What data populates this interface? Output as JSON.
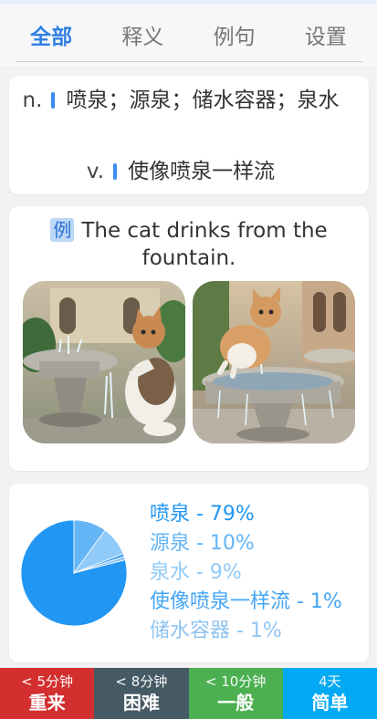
{
  "tabs": [
    {
      "label": "全部",
      "active": true
    },
    {
      "label": "释义",
      "active": false
    },
    {
      "label": "例句",
      "active": false
    },
    {
      "label": "设置",
      "active": false
    }
  ],
  "definitions": [
    {
      "pos": "n.",
      "text": "喷泉；源泉；储水容器；泉水"
    },
    {
      "pos": "v.",
      "text": "使像喷泉一样流"
    }
  ],
  "example": {
    "badge": "例",
    "sentence": "The cat drinks from the fountain.",
    "images": [
      {
        "icon": "cat-fountain-photo-1"
      },
      {
        "icon": "cat-fountain-photo-2"
      }
    ]
  },
  "stats": {
    "items": [
      {
        "label": "喷泉 - 79%",
        "percent": 79,
        "color": "#2196f3"
      },
      {
        "label": "源泉 - 10%",
        "percent": 10,
        "color": "#64b5f6"
      },
      {
        "label": "泉水 - 9%",
        "percent": 9,
        "color": "#90caf9"
      },
      {
        "label": "使像喷泉一样流 - 1%",
        "percent": 1,
        "color": "#42a5f5"
      },
      {
        "label": "储水容器 - 1%",
        "percent": 1,
        "color": "#90c4f0"
      }
    ]
  },
  "buttons": [
    {
      "time": "< 5分钟",
      "label": "重来",
      "color": "#d32f2f"
    },
    {
      "time": "< 8分钟",
      "label": "困难",
      "color": "#455a64"
    },
    {
      "time": "< 10分钟",
      "label": "一般",
      "color": "#4caf50"
    },
    {
      "time": "4天",
      "label": "简单",
      "color": "#03a9f4"
    }
  ]
}
